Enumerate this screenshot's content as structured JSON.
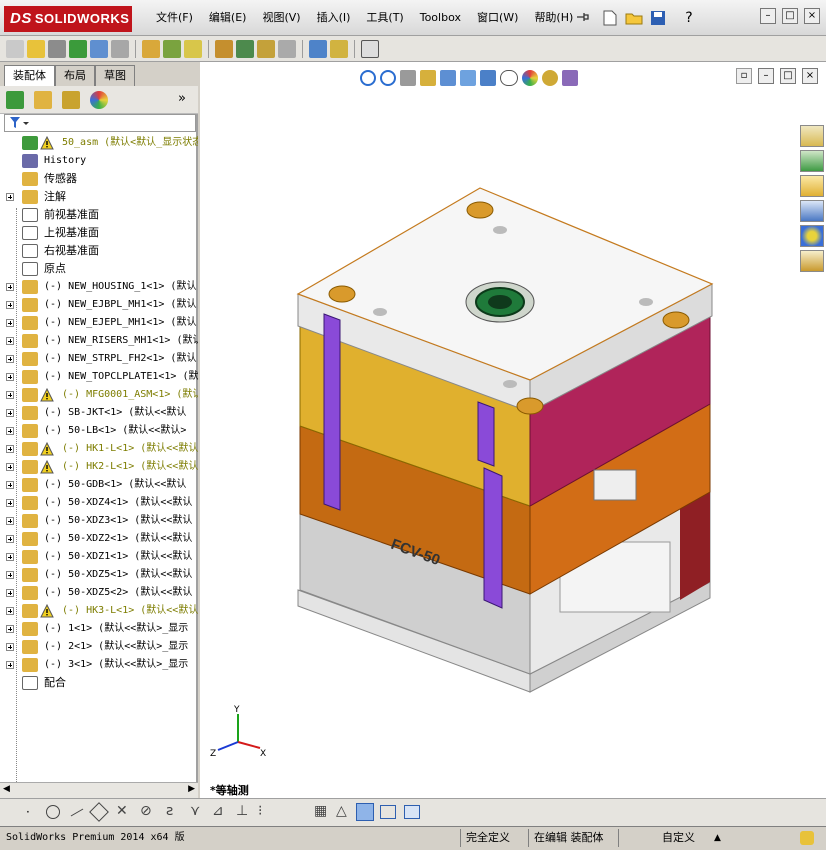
{
  "app": {
    "logo_text": "SOLIDWORKS",
    "logo_prefix": "DS"
  },
  "menu": [
    "文件(F)",
    "编辑(E)",
    "视图(V)",
    "插入(I)",
    "工具(T)",
    "Toolbox",
    "窗口(W)",
    "帮助(H)"
  ],
  "help_label": "?",
  "window_buttons": [
    "–",
    "□",
    "×"
  ],
  "panel_tabs": [
    "装配体",
    "布局",
    "草图"
  ],
  "tree": [
    {
      "label": "50_asm  (默认<默认_显示状态",
      "warn": true,
      "root": true
    },
    {
      "label": "History"
    },
    {
      "label": "传感器",
      "cjk": true
    },
    {
      "label": "注解",
      "cjk": true,
      "exp": true
    },
    {
      "label": "前视基准面",
      "cjk": true
    },
    {
      "label": "上视基准面",
      "cjk": true
    },
    {
      "label": "右视基准面",
      "cjk": true
    },
    {
      "label": "原点",
      "cjk": true
    },
    {
      "label": "(-) NEW_HOUSING_1<1> (默认",
      "exp": true
    },
    {
      "label": "(-) NEW_EJBPL_MH1<1> (默认",
      "exp": true
    },
    {
      "label": "(-) NEW_EJEPL_MH1<1> (默认",
      "exp": true
    },
    {
      "label": "(-) NEW_RISERS_MH1<1> (默认",
      "exp": true
    },
    {
      "label": "(-) NEW_STRPL_FH2<1> (默认",
      "exp": true
    },
    {
      "label": "(-) NEW_TOPCLPLATE1<1> (默",
      "exp": true
    },
    {
      "label": "(-) MFG0001_ASM<1> (默认",
      "exp": true,
      "warn": true
    },
    {
      "label": "(-) SB-JKT<1> (默认<<默认",
      "exp": true
    },
    {
      "label": "(-) 50-LB<1> (默认<<默认>",
      "exp": true
    },
    {
      "label": "(-) HK1-L<1> (默认<<默认",
      "exp": true,
      "warn": true
    },
    {
      "label": "(-) HK2-L<1> (默认<<默认",
      "exp": true,
      "warn": true
    },
    {
      "label": "(-) 50-GDB<1> (默认<<默认",
      "exp": true
    },
    {
      "label": "(-) 50-XDZ4<1> (默认<<默认",
      "exp": true
    },
    {
      "label": "(-) 50-XDZ3<1> (默认<<默认",
      "exp": true
    },
    {
      "label": "(-) 50-XDZ2<1> (默认<<默认",
      "exp": true
    },
    {
      "label": "(-) 50-XDZ1<1> (默认<<默认",
      "exp": true
    },
    {
      "label": "(-) 50-XDZ5<1> (默认<<默认",
      "exp": true
    },
    {
      "label": "(-) 50-XDZ5<2> (默认<<默认",
      "exp": true
    },
    {
      "label": "(-) HK3-L<1> (默认<<默认",
      "exp": true,
      "warn": true
    },
    {
      "label": "(-) 1<1> (默认<<默认>_显示",
      "exp": true
    },
    {
      "label": "(-) 2<1> (默认<<默认>_显示",
      "exp": true
    },
    {
      "label": "(-) 3<1> (默认<<默认>_显示",
      "exp": true
    },
    {
      "label": "配合",
      "cjk": true
    }
  ],
  "viewport": {
    "view_name": "*等轴测",
    "mold_label": "FCV-50",
    "triad": {
      "x": "X",
      "y": "Y",
      "z": "Z"
    }
  },
  "status": {
    "version": "SolidWorks Premium 2014 x64 版",
    "definition": "完全定义",
    "editing": "在编辑 装配体",
    "units": "自定义"
  }
}
